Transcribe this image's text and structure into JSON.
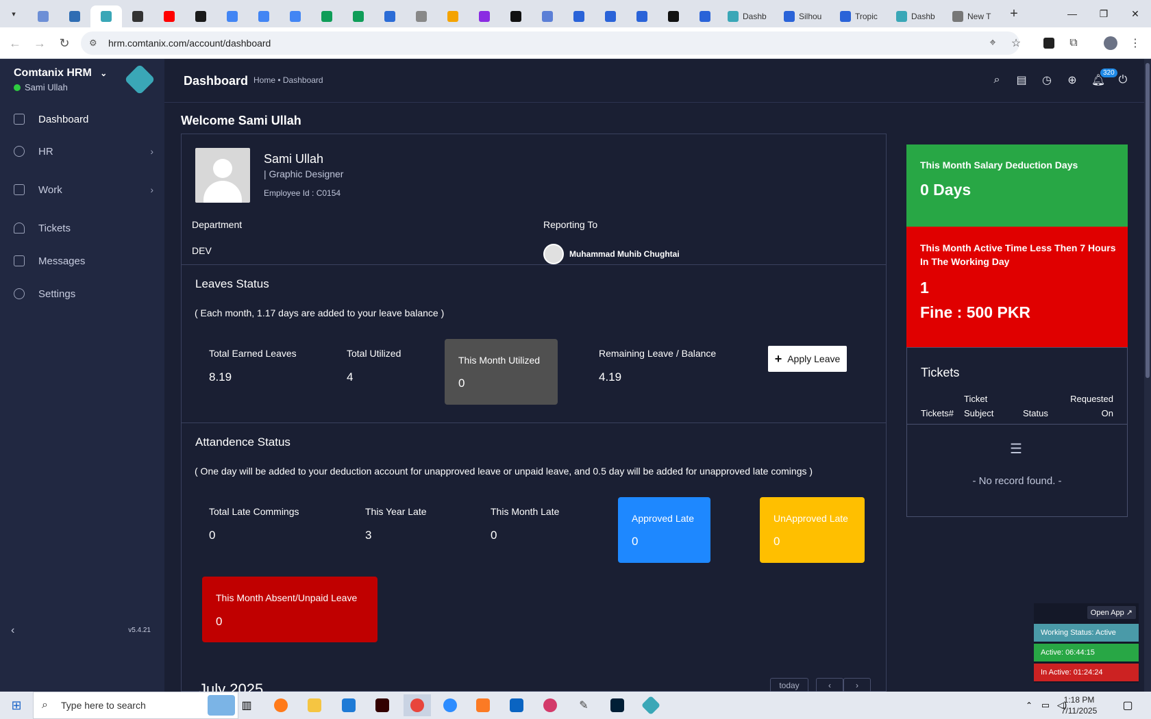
{
  "browser": {
    "tabs": [
      {
        "title": "",
        "color": "#6d8fd6"
      },
      {
        "title": "",
        "color": "#2f6db3"
      },
      {
        "title": "",
        "color": "#3aa7b7",
        "active": true
      },
      {
        "title": "",
        "color": "#333333"
      },
      {
        "title": "",
        "color": "#ff0000"
      },
      {
        "title": "",
        "color": "#1a1a1a"
      },
      {
        "title": "",
        "color": "#4285f4"
      },
      {
        "title": "",
        "color": "#4285f4"
      },
      {
        "title": "",
        "color": "#4285f4"
      },
      {
        "title": "",
        "color": "#0f9d58"
      },
      {
        "title": "",
        "color": "#0f9d58"
      },
      {
        "title": "",
        "color": "#2b6cd6"
      },
      {
        "title": "",
        "color": "#888888"
      },
      {
        "title": "",
        "color": "#f4a300"
      },
      {
        "title": "",
        "color": "#8a2be2"
      },
      {
        "title": "",
        "color": "#111111"
      },
      {
        "title": "",
        "color": "#5b7fd6"
      },
      {
        "title": "",
        "color": "#2a63d8"
      },
      {
        "title": "",
        "color": "#2a63d8"
      },
      {
        "title": "",
        "color": "#2a63d8"
      },
      {
        "title": "",
        "color": "#111111"
      },
      {
        "title": "",
        "color": "#2a63d8"
      },
      {
        "title": "Dashb",
        "color": "#3aa7b7"
      },
      {
        "title": "Silhou",
        "color": "#2a63d8"
      },
      {
        "title": "Tropic",
        "color": "#2a63d8"
      },
      {
        "title": "Dashb",
        "color": "#3aa7b7"
      },
      {
        "title": "New T",
        "color": "#777777"
      }
    ],
    "url": "hrm.comtanix.com/account/dashboard"
  },
  "sidebar": {
    "brand": "Comtanix HRM",
    "user": "Sami Ullah",
    "items": [
      {
        "label": "Dashboard",
        "icon": "home-icon"
      },
      {
        "label": "HR",
        "icon": "users-icon"
      },
      {
        "label": "Work",
        "icon": "briefcase-icon"
      },
      {
        "label": "Tickets",
        "icon": "headset-icon"
      },
      {
        "label": "Messages",
        "icon": "message-icon"
      },
      {
        "label": "Settings",
        "icon": "gear-icon"
      }
    ],
    "version": "v5.4.21"
  },
  "header": {
    "title": "Dashboard",
    "breadcrumb": "Home • Dashboard",
    "notification_count": "320"
  },
  "welcome": "Welcome Sami Ullah",
  "profile": {
    "name": "Sami Ullah",
    "role": "| Graphic Designer",
    "employee_id": "Employee Id : C0154",
    "department_label": "Department",
    "department": "DEV",
    "reporting_label": "Reporting To",
    "reporting_to": "Muhammad Muhib Chughtai"
  },
  "leaves": {
    "title": "Leaves Status",
    "note": "( Each month, 1.17 days are added to your leave balance )",
    "total_earned_label": "Total Earned Leaves",
    "total_earned": "8.19",
    "total_utilized_label": "Total Utilized",
    "total_utilized": "4",
    "month_utilized_label": "This Month Utilized",
    "month_utilized": "0",
    "remaining_label": "Remaining Leave / Balance",
    "remaining": "4.19",
    "apply_label": "Apply Leave"
  },
  "attendance": {
    "title": "Attandence Status",
    "note": "( One day will be added to your deduction account for unapproved leave or unpaid leave, and 0.5 day will be added for unapproved late comings )",
    "total_late_label": "Total Late Commings",
    "total_late": "0",
    "year_late_label": "This Year Late",
    "year_late": "3",
    "month_late_label": "This Month Late",
    "month_late": "0",
    "approved_label": "Approved Late",
    "approved": "0",
    "unapproved_label": "UnApproved Late",
    "unapproved": "0",
    "absent_label": "This Month Absent/Unpaid Leave",
    "absent": "0"
  },
  "calendar": {
    "month": "July 2025",
    "today_label": "today"
  },
  "salary_card": {
    "label": "This Month Salary Deduction Days",
    "value": "0 Days",
    "color": "#28a745"
  },
  "fine_card": {
    "label": "This Month Active Time Less Then 7 Hours In The Working Day",
    "count": "1",
    "fine": "Fine : 500 PKR",
    "color": "#e00000"
  },
  "tickets": {
    "title": "Tickets",
    "col1": "Tickets#",
    "col2_top": "Ticket",
    "col2_bottom": "Subject",
    "col3": "Status",
    "col4_top": "Requested",
    "col4_bottom": "On",
    "empty": "- No record found. -"
  },
  "status_widget": {
    "open_app": "Open App ↗",
    "working": "Working Status: Active",
    "active": "Active: 06:44:15",
    "inactive": "In Active: 01:24:24"
  },
  "taskbar": {
    "search_placeholder": "Type here to search",
    "time": "1:18 PM",
    "date": "7/11/2025"
  }
}
